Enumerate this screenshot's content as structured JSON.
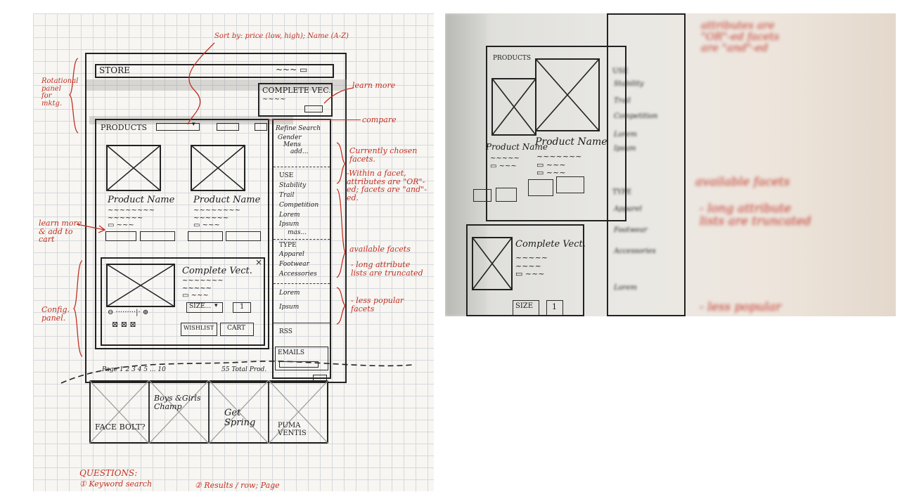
{
  "left_sketch": {
    "store_label": "STORE",
    "complete_vec_label": "COMPLETE VEC.",
    "products_label": "PRODUCTS",
    "refine_search_label": "Refine Search",
    "refine_gender": "Gender",
    "refine_mens": "Mens",
    "refine_add": "add...",
    "facet_use": "USE",
    "facet_use_items": [
      "Stability",
      "Trail",
      "Competition",
      "Lorem",
      "Ipsum"
    ],
    "facet_more": "mas...",
    "facet_type": "TYPE",
    "facet_type_items": [
      "Apparel",
      "Footwear",
      "Accessories"
    ],
    "facet_lorem": "Lorem",
    "facet_ipsum": "Ipsum",
    "rss_label": "RSS",
    "emails_label": "EMAILS",
    "product_name_1": "Product Name",
    "product_name_2": "Product Name",
    "config_title": "Complete Vect.",
    "config_size": "SIZE...",
    "config_qty": "1",
    "wishlist_btn": "WISHLIST",
    "cart_btn": "CART",
    "close_x": "×",
    "pagination": "Page 1 2 3 4 5 ... 10",
    "total_label": "55 Total Prod.",
    "promo_1": "FACE BOLT?",
    "promo_2": "Boys &Girls Champ",
    "promo_3": "Get Spring",
    "promo_4": "PUMA VENTIS",
    "annotation_sort": "Sort by: price (low, high); Name (A-Z)",
    "annotation_learn_more": "learn more",
    "annotation_compare": "compare",
    "annotation_side_panel": "Rotational panel for mktg.",
    "annotation_chosen_facets": "Currently chosen facets.",
    "annotation_or": "-Within a facet, attributes are \"OR\"-ed; facets are \"and\"-ed.",
    "annotation_available": "available facets",
    "annotation_long_lists": "- long attribute lists are truncated",
    "annotation_less_popular": "- less popular facets",
    "annotation_learn_add": "learn more & add to cart",
    "annotation_config": "Config. panel.",
    "questions_title": "QUESTIONS:",
    "question_1": "① Keyword search",
    "question_2": "② Results / row; Page"
  },
  "right_photo": {
    "products_label": "PRODUCTS",
    "product_name_1": "Product Name",
    "product_name_2": "Product Name",
    "config_title": "Complete Vect.",
    "config_size": "SIZE",
    "config_qty": "1",
    "facet_use": "USE",
    "facet_use_items": [
      "Stability",
      "Trail",
      "Competition",
      "Lorem",
      "Ipsum"
    ],
    "facet_type": "TYPE",
    "facet_type_items": [
      "Apparel",
      "Footwear",
      "Accessories"
    ],
    "facet_lorem": "Lorem",
    "annotation_top": "attributes are \"OR\"-ed facets are \"and\"-ed",
    "annotation_available": "available facets",
    "annotation_long": "- long attribute lists are truncated",
    "annotation_less": "- less popular"
  }
}
